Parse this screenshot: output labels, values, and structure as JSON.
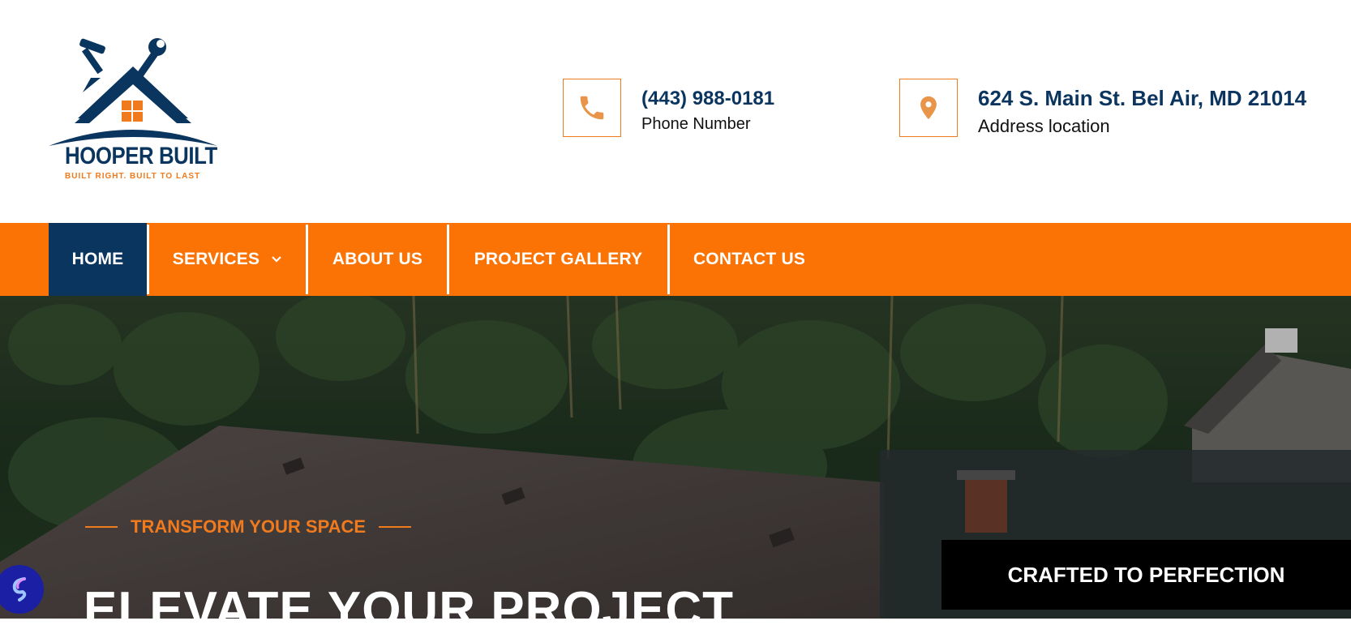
{
  "brand": {
    "name": "HOOPER BUILT",
    "tagline": "BUILT RIGHT. BUILT TO LAST",
    "logo_icon": "house-with-hammer-and-wrench-icon"
  },
  "contact": {
    "phone": {
      "icon": "phone-icon",
      "value": "(443) 988-0181",
      "label": "Phone Number"
    },
    "address": {
      "icon": "map-pin-icon",
      "value": "624 S. Main St. Bel Air, MD 21014",
      "label": "Address location"
    }
  },
  "nav": {
    "items": [
      {
        "label": "HOME",
        "active": true
      },
      {
        "label": "SERVICES",
        "has_dropdown": true
      },
      {
        "label": "ABOUT US"
      },
      {
        "label": "PROJECT GALLERY"
      },
      {
        "label": "CONTACT US"
      }
    ]
  },
  "hero": {
    "eyebrow": "TRANSFORM YOUR SPACE",
    "title": "ELEVATE YOUR PROJECT",
    "badge": "CRAFTED TO PERFECTION"
  },
  "colors": {
    "orange": "#fb7304",
    "navy": "#0a355f",
    "accent_orange": "#f07a1e"
  }
}
